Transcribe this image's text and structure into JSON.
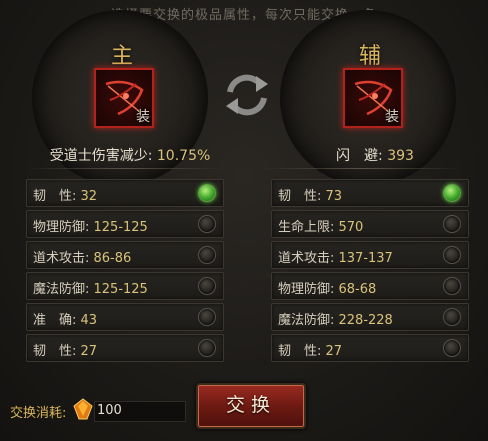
{
  "hint": "选择要交换的极品属性，每次只能交换一条",
  "main_slot": {
    "title": "主",
    "equip_tag": "装",
    "main_stat_label": "受道士伤害减少: ",
    "main_stat_value": "10.75%"
  },
  "aux_slot": {
    "title": "辅",
    "equip_tag": "装",
    "main_stat_label": "闪　避: ",
    "main_stat_value": "393"
  },
  "left_stats": [
    {
      "label": "韧　性: ",
      "value": "32",
      "selected": true
    },
    {
      "label": "物理防御: ",
      "value": "125-125",
      "selected": false
    },
    {
      "label": "道术攻击: ",
      "value": "86-86",
      "selected": false
    },
    {
      "label": "魔法防御: ",
      "value": "125-125",
      "selected": false
    },
    {
      "label": "准　确: ",
      "value": "43",
      "selected": false
    },
    {
      "label": "韧　性: ",
      "value": "27",
      "selected": false
    }
  ],
  "right_stats": [
    {
      "label": "韧　性: ",
      "value": "73",
      "selected": true
    },
    {
      "label": "生命上限: ",
      "value": "570",
      "selected": false
    },
    {
      "label": "道术攻击: ",
      "value": "137-137",
      "selected": false
    },
    {
      "label": "物理防御: ",
      "value": "68-68",
      "selected": false
    },
    {
      "label": "魔法防御: ",
      "value": "228-228",
      "selected": false
    },
    {
      "label": "韧　性: ",
      "value": "27",
      "selected": false
    }
  ],
  "footer": {
    "cost_label": "交换消耗:",
    "cost_value": "100",
    "swap_button": "交换"
  },
  "colors": {
    "accent_gold": "#d8b45a",
    "button_red": "#9a2a20",
    "radio_on": "#3ea52a"
  },
  "icons": {
    "swap": "swap-arrows-icon",
    "equipment": "bow-equipment-icon",
    "currency": "gem-icon"
  }
}
